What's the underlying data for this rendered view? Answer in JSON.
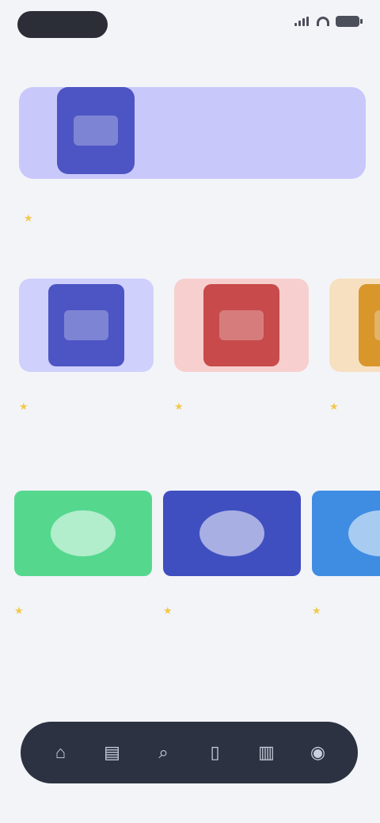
{
  "status_bar": {
    "icons": [
      "signal-icon",
      "wifi-icon",
      "battery-icon"
    ]
  },
  "header": {
    "search_hint": ""
  },
  "featured": {
    "title": "",
    "subtitle": "",
    "colors": {
      "banner": "#c8c8fb",
      "art": "#4d55c4"
    }
  },
  "sections": {
    "books_title": "",
    "courses_title": ""
  },
  "books": [
    {
      "title": "",
      "subtitle": "",
      "bg": "#cfd0fb",
      "cover": "#4d55c4"
    },
    {
      "title": "",
      "subtitle": "",
      "bg": "#f7cfcf",
      "cover": "#c84a4a"
    },
    {
      "title": "",
      "subtitle": "",
      "bg": "#f7e0c0",
      "cover": "#d9962b"
    }
  ],
  "courses": [
    {
      "title": "",
      "subtitle": "",
      "bg": "#55d88e"
    },
    {
      "title": "",
      "subtitle": "",
      "bg": "#3f4fc0"
    },
    {
      "title": "",
      "subtitle": "",
      "bg": "#3f8de2"
    }
  ],
  "footer": {
    "view_all": ""
  },
  "tabbar": {
    "tabs": [
      {
        "icon": "home-icon",
        "glyph": "⌂"
      },
      {
        "icon": "book-icon",
        "glyph": "▤"
      },
      {
        "icon": "search-icon",
        "glyph": "⌕"
      },
      {
        "icon": "bookmark-icon",
        "glyph": "▯"
      },
      {
        "icon": "chart-icon",
        "glyph": "▥"
      },
      {
        "icon": "profile-icon",
        "glyph": "◉"
      }
    ]
  }
}
